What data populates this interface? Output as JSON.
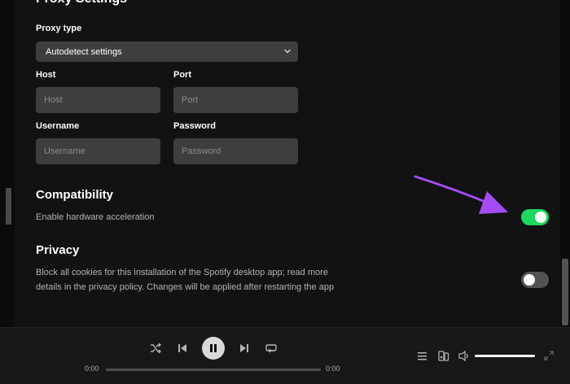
{
  "proxy": {
    "section_title": "Proxy Settings",
    "type_label": "Proxy type",
    "type_value": "Autodetect settings",
    "host_label": "Host",
    "host_placeholder": "Host",
    "port_label": "Port",
    "port_placeholder": "Port",
    "username_label": "Username",
    "username_placeholder": "Username",
    "password_label": "Password",
    "password_placeholder": "Password"
  },
  "compatibility": {
    "title": "Compatibility",
    "hardware_acceleration_label": "Enable hardware acceleration",
    "hardware_acceleration_enabled": true
  },
  "privacy": {
    "title": "Privacy",
    "cookies_line1": "Block all cookies for this installation of the Spotify desktop app; read more",
    "cookies_line2": "details in the privacy policy. Changes will be applied after restarting the app",
    "block_cookies_enabled": false
  },
  "player": {
    "elapsed": "0:00",
    "duration": "0:00",
    "progress": 0,
    "volume": 1.0
  },
  "colors": {
    "toggle_on": "#1ed760",
    "toggle_off": "#535353",
    "annotation_arrow": "#a64bf4"
  },
  "icons": [
    "chevron-down-icon",
    "shuffle-icon",
    "previous-icon",
    "pause-icon",
    "next-icon",
    "repeat-icon",
    "queue-icon",
    "connect-device-icon",
    "volume-icon",
    "fullscreen-icon"
  ]
}
